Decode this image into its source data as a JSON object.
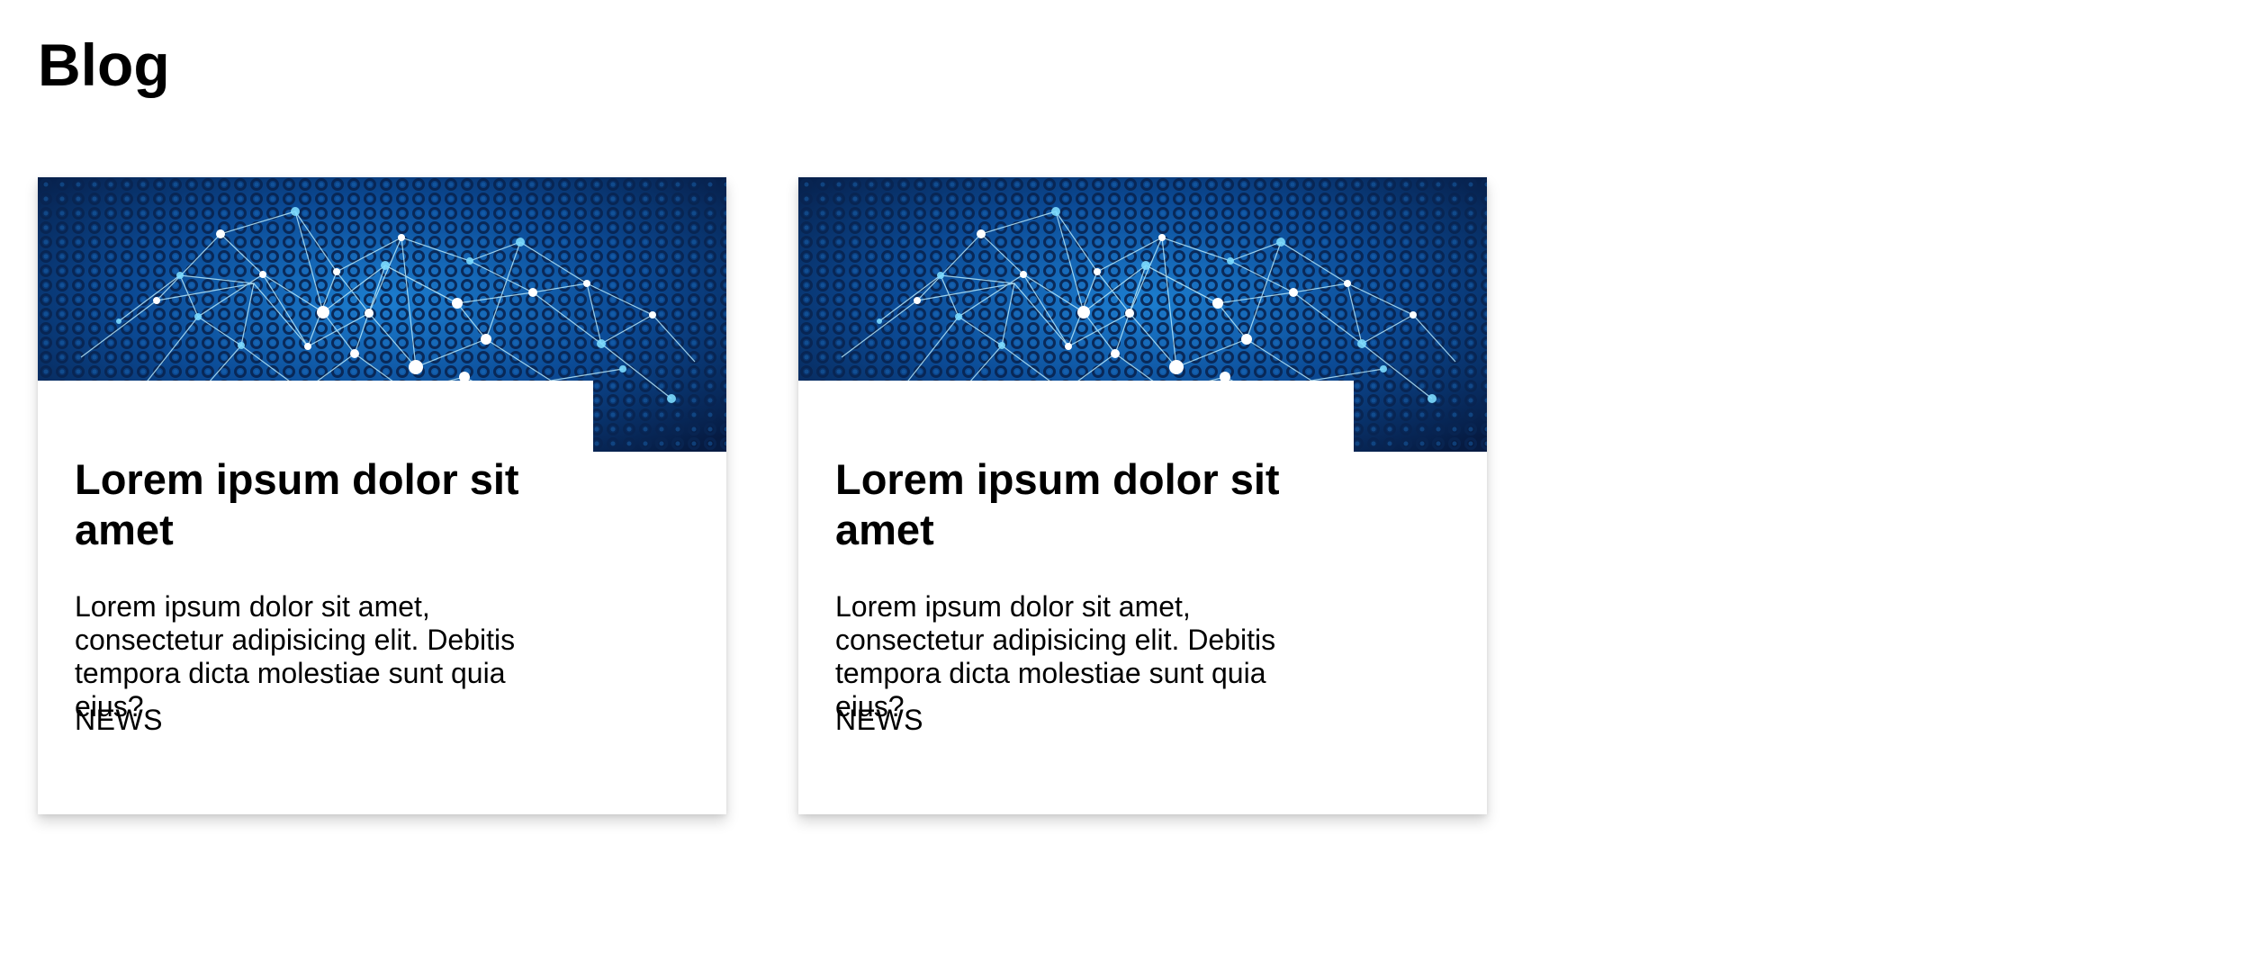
{
  "page": {
    "title": "Blog"
  },
  "posts": [
    {
      "title": "Lorem ipsum dolor sit amet",
      "excerpt": "Lorem ipsum dolor sit amet, consectetur adipisicing elit. Debitis tempora dicta molestiae sunt quia eius?",
      "category": "NEWS",
      "image_icon": "network-image"
    },
    {
      "title": "Lorem ipsum dolor sit amet",
      "excerpt": "Lorem ipsum dolor sit amet, consectetur adipisicing elit. Debitis tempora dicta molestiae sunt quia eius?",
      "category": "NEWS",
      "image_icon": "network-image"
    }
  ],
  "colors": {
    "image_background": "#0b2f66",
    "image_dark": "#04132f",
    "image_accent": "#73d7ff",
    "text": "#000000",
    "surface": "#ffffff"
  }
}
